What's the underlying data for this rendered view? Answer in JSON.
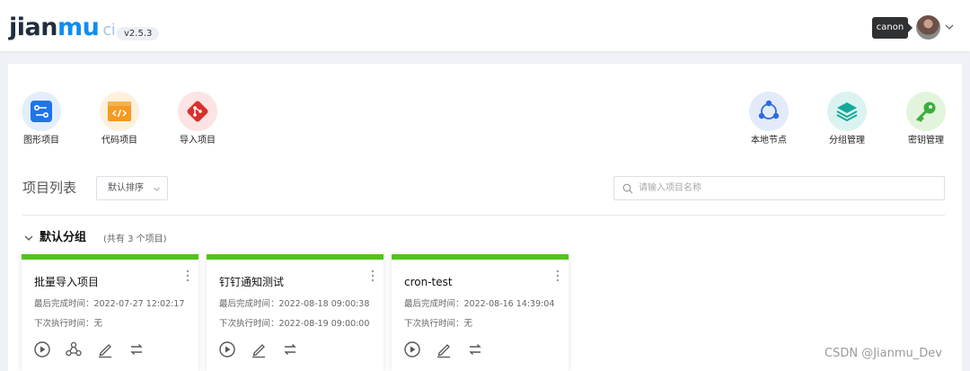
{
  "header": {
    "logo_main": "jian",
    "logo_accent": "mu",
    "logo_suffix": "ci",
    "version": "v2.5.3",
    "user_tooltip": "canon"
  },
  "quick_actions_left": [
    {
      "label": "图形项目",
      "icon": "graph-icon",
      "color": "#1f74e8"
    },
    {
      "label": "代码项目",
      "icon": "code-icon",
      "color": "#f59a23"
    },
    {
      "label": "导入项目",
      "icon": "git-icon",
      "color": "#d9302c"
    }
  ],
  "quick_actions_right": [
    {
      "label": "本地节点",
      "icon": "node-share-icon",
      "color": "#2f6be0"
    },
    {
      "label": "分组管理",
      "icon": "layers-icon",
      "color": "#16a89a"
    },
    {
      "label": "密钥管理",
      "icon": "key-icon",
      "color": "#3cae3c"
    }
  ],
  "toolbar": {
    "list_title": "项目列表",
    "sort_value": "默认排序",
    "search_placeholder": "请输入项目名称",
    "search_value": ""
  },
  "group": {
    "name": "默认分组",
    "count_text": "(共有 3 个项目)"
  },
  "projects": [
    {
      "name": "批量导入项目",
      "last_done": "最后完成时间：2022-07-27 12:02:17",
      "next_run": "下次执行时间：无",
      "status_color": "#52c41a",
      "actions": [
        "play-icon",
        "workflow-icon",
        "edit-icon",
        "sync-icon"
      ]
    },
    {
      "name": "钉钉通知测试",
      "last_done": "最后完成时间：2022-08-18 09:00:38",
      "next_run": "下次执行时间：2022-08-19 09:00:00",
      "status_color": "#52c41a",
      "actions": [
        "play-icon",
        "edit-icon",
        "sync-icon"
      ]
    },
    {
      "name": "cron-test",
      "last_done": "最后完成时间：2022-08-16 14:39:04",
      "next_run": "下次执行时间：无",
      "status_color": "#52c41a",
      "actions": [
        "play-icon",
        "edit-icon",
        "sync-icon"
      ]
    }
  ],
  "watermark": "CSDN @Jianmu_Dev",
  "colors": {
    "accent": "#0f8ef0",
    "success": "#52c41a",
    "background": "#eef1f6"
  }
}
